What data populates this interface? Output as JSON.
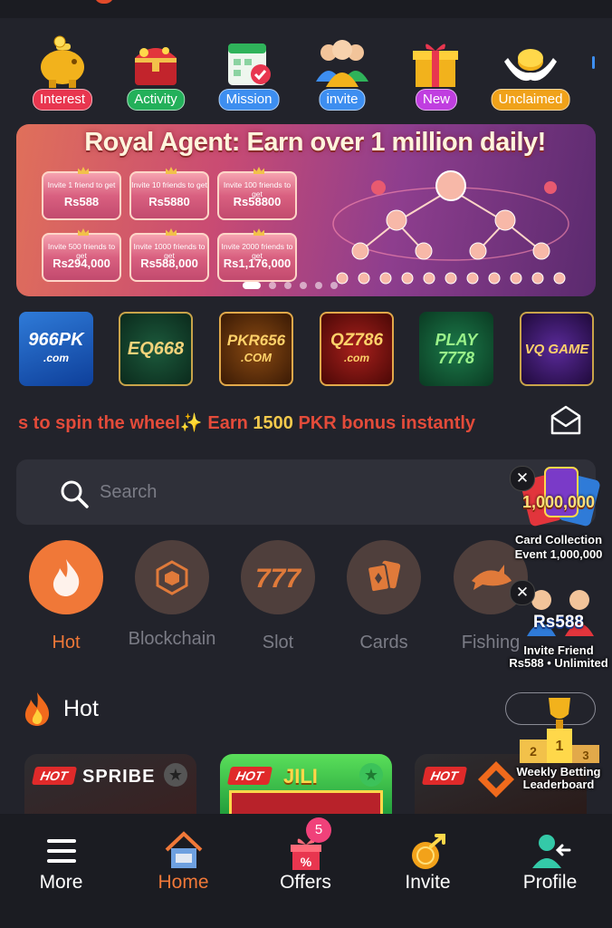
{
  "quick_actions": [
    {
      "label": "Interest",
      "color": "#e8364f"
    },
    {
      "label": "Activity",
      "color": "#23b05a"
    },
    {
      "label": "Mission",
      "color": "#3d8ef0"
    },
    {
      "label": "invite",
      "color": "#3d8ef0"
    },
    {
      "label": "New",
      "color": "#c03ee0"
    },
    {
      "label": "Unclaimed",
      "color": "#f0a21a"
    }
  ],
  "banner": {
    "title": "Royal Agent: Earn over 1 million daily!",
    "tiers": [
      {
        "label": "Invite 1 friend to get",
        "value": "Rs588"
      },
      {
        "label": "Invite 10 friends to get",
        "value": "Rs5880"
      },
      {
        "label": "Invite 100 friends to get",
        "value": "Rs58800"
      },
      {
        "label": "Invite 500 friends to get",
        "value": "Rs294,000"
      },
      {
        "label": "Invite 1000 friends to get",
        "value": "Rs588,000"
      },
      {
        "label": "Invite 2000 friends to get",
        "value": "Rs1,176,000"
      }
    ]
  },
  "partners": [
    "966PK",
    "EQ668",
    "PKR656",
    "QZ786",
    "PLAY 7778",
    "VQ GAME"
  ],
  "partner_subs": [
    ".com",
    "",
    ".COM",
    ".com",
    "",
    ""
  ],
  "marquee": {
    "pre": "s to spin the wheel✨ Earn ",
    "amount": "1500",
    "post": " PKR bonus instantly"
  },
  "search": {
    "placeholder": "Search"
  },
  "categories": [
    "Hot",
    "Blockchain",
    "Slot",
    "Cards",
    "Fishing"
  ],
  "hot_section": {
    "title": "Hot"
  },
  "games": [
    {
      "badge": "HOT",
      "brand": "SPRIBE"
    },
    {
      "badge": "HOT",
      "brand": "JILI"
    },
    {
      "badge": "HOT",
      "brand": ""
    }
  ],
  "promos": {
    "card_collection": {
      "amount": "1,000,000",
      "line1": "Card Collection",
      "line2": "Event 1,000,000"
    },
    "invite_friend": {
      "amount": "Rs588",
      "line1": "Invite Friend",
      "line2": "Rs588 • Unlimited"
    },
    "leaderboard": {
      "line1": "Weekly Betting",
      "line2": "Leaderboard"
    }
  },
  "nav": {
    "items": [
      "More",
      "Home",
      "Offers",
      "Invite",
      "Profile"
    ],
    "offers_badge": "5"
  },
  "colors": {
    "accent": "#f07838",
    "background": "#22232b",
    "marquee": "#e34b3a",
    "highlight": "#f2c94c"
  }
}
